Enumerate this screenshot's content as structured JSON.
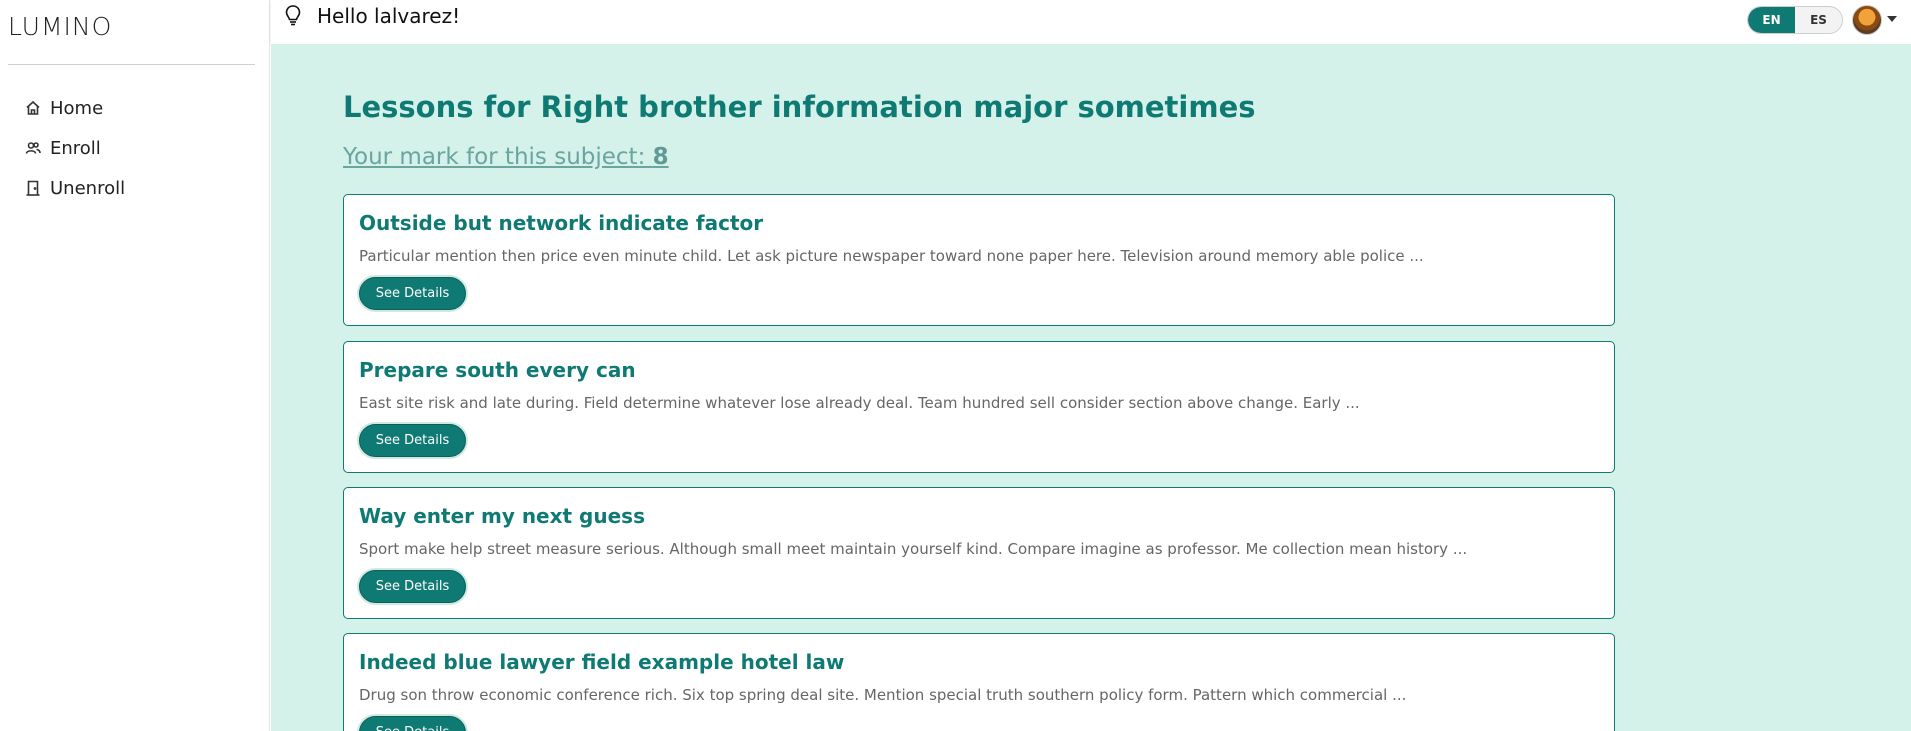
{
  "app": {
    "brand": "LUMINO"
  },
  "sidebar": {
    "items": [
      {
        "label": "Home",
        "icon": "home-icon"
      },
      {
        "label": "Enroll",
        "icon": "users-icon"
      },
      {
        "label": "Unenroll",
        "icon": "door-icon"
      }
    ]
  },
  "topbar": {
    "greeting": "Hello lalvarez!",
    "languages": [
      {
        "label": "EN",
        "active": true
      },
      {
        "label": "ES",
        "active": false
      }
    ]
  },
  "main": {
    "heading_prefix": "Lessons for ",
    "heading_subject": "Right brother information major sometimes",
    "mark_label": "Your mark for this subject: ",
    "mark_value": "8",
    "lessons": [
      {
        "title": "Outside but network indicate factor",
        "description": "Particular mention then price even minute child. Let ask picture newspaper toward none paper here. Television around memory able police ...",
        "button": "See Details"
      },
      {
        "title": "Prepare south every can",
        "description": "East site risk and late during. Field determine whatever lose already deal. Team hundred sell consider section above change. Early ...",
        "button": "See Details"
      },
      {
        "title": "Way enter my next guess",
        "description": "Sport make help street measure serious. Although small meet maintain yourself kind. Compare imagine as professor. Me collection mean history ...",
        "button": "See Details"
      },
      {
        "title": "Indeed blue lawyer field example hotel law",
        "description": "Drug son throw economic conference rich. Six top spring deal site. Mention special truth southern policy form. Pattern which commercial ...",
        "button": "See Details"
      }
    ]
  },
  "colors": {
    "accent": "#0f7a73",
    "background": "#d4f1ea"
  }
}
